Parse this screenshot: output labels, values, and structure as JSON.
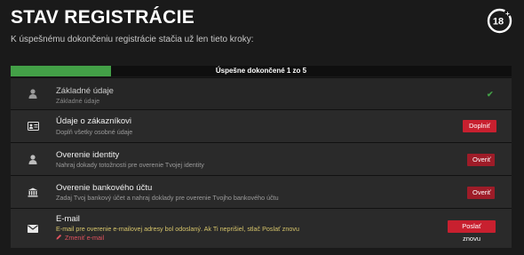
{
  "header": {
    "title": "STAV REGISTRÁCIE",
    "subtitle": "K úspešnému dokončeniu registrácie stačia už len tieto kroky:",
    "age_badge": "18+"
  },
  "progress": {
    "completed": 1,
    "total": 5,
    "label": "Úspešne dokončené 1 zo 5",
    "fill_color": "#43a047"
  },
  "steps": [
    {
      "icon": "user-icon",
      "title": "Základné údaje",
      "description": "Základné údaje",
      "status": "done"
    },
    {
      "icon": "id-card-icon",
      "title": "Údaje o zákazníkovi",
      "description": "Doplň všetky osobné údaje",
      "button": "Doplniť"
    },
    {
      "icon": "user-icon",
      "title": "Overenie identity",
      "description": "Nahraj dokady totožnosti pre overenie Tvojej identity",
      "button": "Overiť"
    },
    {
      "icon": "bank-icon",
      "title": "Overenie bankového účtu",
      "description": "Zadaj Tvoj bankový účet a nahraj doklady pre overenie Tvojho bankového účtu",
      "button": "Overiť"
    },
    {
      "icon": "envelope-icon",
      "title": "E-mail",
      "description": "E-mail pre overenie e-mailovej adresy bol odoslaný. Ak Ti neprišiel, stlač Poslať znovu",
      "link": "Zmeniť e-mail",
      "button": "Poslať znovu"
    }
  ],
  "colors": {
    "accent_red": "#c8202f",
    "success_green": "#43a047",
    "warning_text": "#d6c46a"
  }
}
